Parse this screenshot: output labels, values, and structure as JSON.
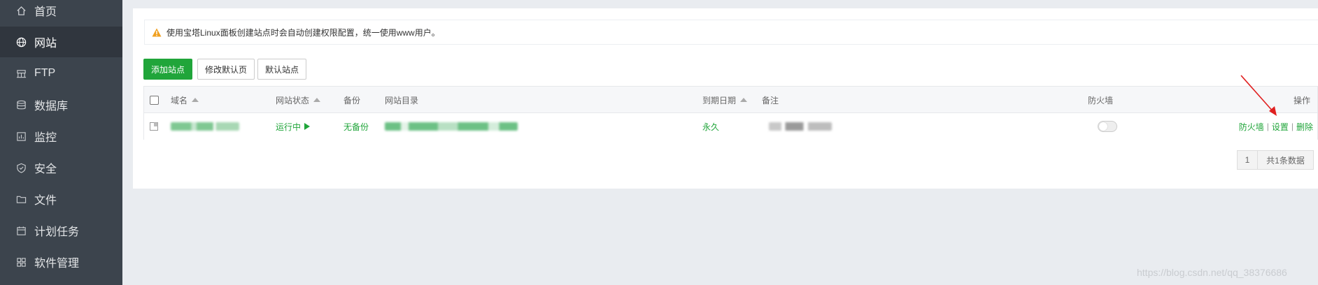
{
  "sidebar": {
    "items": [
      {
        "label": "首页",
        "icon": "home-icon"
      },
      {
        "label": "网站",
        "icon": "globe-icon",
        "active": true
      },
      {
        "label": "FTP",
        "icon": "ftp-icon"
      },
      {
        "label": "数据库",
        "icon": "database-icon"
      },
      {
        "label": "监控",
        "icon": "monitor-icon"
      },
      {
        "label": "安全",
        "icon": "shield-icon"
      },
      {
        "label": "文件",
        "icon": "folder-icon"
      },
      {
        "label": "计划任务",
        "icon": "calendar-icon"
      },
      {
        "label": "软件管理",
        "icon": "grid-icon"
      }
    ]
  },
  "notice": {
    "text": "使用宝塔Linux面板创建站点时会自动创建权限配置，统一使用www用户。"
  },
  "toolbar": {
    "add_site": "添加站点",
    "edit_default_page": "修改默认页",
    "default_site": "默认站点"
  },
  "table": {
    "headers": {
      "domain": "域名",
      "status": "网站状态",
      "backup": "备份",
      "root": "网站目录",
      "expire": "到期日期",
      "remark": "备注",
      "firewall": "防火墙",
      "actions": "操作"
    },
    "rows": [
      {
        "status": "运行中",
        "backup": "无备份",
        "expire": "永久",
        "firewall_enabled": false,
        "actions": [
          "防火墙",
          "设置",
          "删除"
        ]
      }
    ]
  },
  "pagination": {
    "page": "1",
    "total": "共1条数据"
  },
  "watermark": "https://blog.csdn.net/qq_38376686",
  "colors": {
    "accent": "#20a53a",
    "sidebar": "#3c444d",
    "annotation_arrow": "#e02020"
  }
}
